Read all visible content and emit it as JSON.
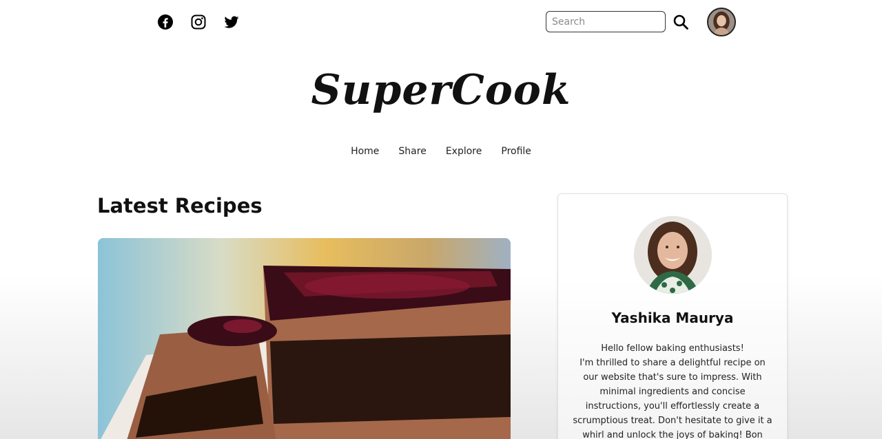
{
  "header": {
    "social": [
      {
        "name": "facebook-icon"
      },
      {
        "name": "instagram-icon"
      },
      {
        "name": "twitter-icon"
      }
    ],
    "search": {
      "placeholder": "Search",
      "value": ""
    },
    "search_icon": "search-icon"
  },
  "brand": {
    "title": "SuperCook"
  },
  "nav": {
    "items": [
      {
        "label": "Home"
      },
      {
        "label": "Share"
      },
      {
        "label": "Explore"
      },
      {
        "label": "Profile"
      }
    ]
  },
  "main": {
    "section_title": "Latest Recipes"
  },
  "profile": {
    "name": "Yashika Maurya",
    "bio_greeting": "Hello fellow baking enthusiasts!",
    "bio_body": "I'm thrilled to share a delightful recipe on our website that's sure to impress. With minimal ingredients and concise instructions, you'll effortlessly create a scrumptious treat. Don't hesitate to give it a whirl and unlock the joys of baking! Bon appétit!"
  },
  "colors": {
    "text": "#111111",
    "border": "#e0e0e0"
  }
}
